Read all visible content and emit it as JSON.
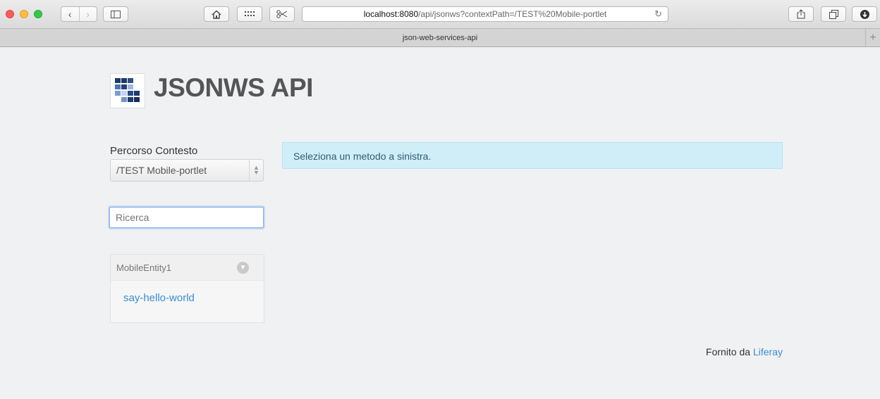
{
  "browser": {
    "address_host": "localhost:8080",
    "address_path": "/api/jsonws?contextPath=/TEST%20Mobile-portlet",
    "tab_title": "json-web-services-api",
    "back_glyph": "‹",
    "forward_glyph": "›",
    "icons": [
      "close-button",
      "minimize-button",
      "maximize-button",
      "back-icon",
      "forward-icon",
      "sidebar-icon",
      "home-icon",
      "grid-icon",
      "scissors-icon",
      "reload-icon",
      "share-icon",
      "tabs-icon",
      "download-icon",
      "new-tab-icon"
    ]
  },
  "header": {
    "title": "JSONWS API",
    "logo_icon": "jsonws-logo"
  },
  "sidebar": {
    "context_label": "Percorso Contesto",
    "context_value": "/TEST Mobile-portlet",
    "search_placeholder": "Ricerca",
    "groups": [
      {
        "title": "MobileEntity1",
        "methods": [
          "say-hello-world"
        ]
      }
    ]
  },
  "main": {
    "info_message": "Seleziona un metodo a sinistra."
  },
  "footer": {
    "prefix": "Fornito da",
    "link_label": "Liferay"
  },
  "colors": {
    "page_bg": "#f0f1f3",
    "info_bg": "#d0eef8",
    "link": "#3a8ed6"
  }
}
